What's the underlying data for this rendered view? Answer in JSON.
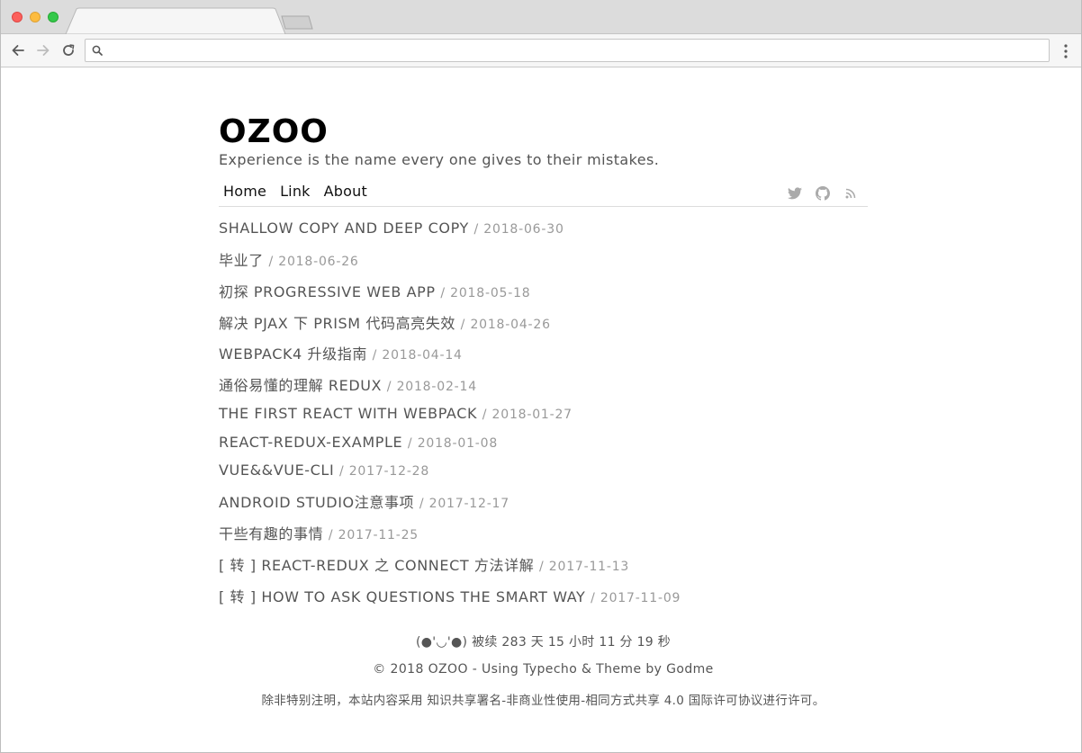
{
  "browser": {
    "address_value": "",
    "icons": [
      "back-arrow-icon",
      "forward-arrow-icon",
      "reload-icon",
      "search-icon",
      "kebab-menu-icon"
    ]
  },
  "site": {
    "title": "OZOO",
    "description": "Experience is the name every one gives to their mistakes."
  },
  "nav": {
    "items": [
      "Home",
      "Link",
      "About"
    ],
    "social": [
      "twitter-icon",
      "github-icon",
      "rss-icon"
    ]
  },
  "posts": [
    {
      "title": "Shallow copy and deep copy",
      "date": "/ 2018-06-30"
    },
    {
      "title": "毕业了",
      "date": "/ 2018-06-26"
    },
    {
      "title": "初探 Progressive Web App",
      "date": "/ 2018-05-18"
    },
    {
      "title": "解决 PJAX 下 Prism 代码高亮失效",
      "date": "/ 2018-04-26"
    },
    {
      "title": "Webpack4 升级指南",
      "date": "/ 2018-04-14"
    },
    {
      "title": "通俗易懂的理解 Redux",
      "date": "/ 2018-02-14"
    },
    {
      "title": "The first React with Webpack",
      "date": "/ 2018-01-27"
    },
    {
      "title": "React-Redux-Example",
      "date": "/ 2018-01-08"
    },
    {
      "title": "Vue&&Vue-cli",
      "date": "/ 2017-12-28"
    },
    {
      "title": "Android Studio注意事项",
      "date": "/ 2017-12-17"
    },
    {
      "title": "干些有趣的事情",
      "date": "/ 2017-11-25"
    },
    {
      "title": "[ 转 ] React-Redux 之 connect 方法详解",
      "date": "/ 2017-11-13"
    },
    {
      "title": "[ 转 ] How To Ask Questions The Smart Way",
      "date": "/ 2017-11-09"
    }
  ],
  "footer": {
    "uptime": "(●'◡'●) 被续 283 天 15 小时 11 分 19 秒",
    "copyright": "© 2018 OZOO - Using Typecho & Theme by Godme",
    "license": "除非特别注明，本站内容采用 知识共享署名-非商业性使用-相同方式共享 4.0 国际许可协议进行许可。"
  }
}
